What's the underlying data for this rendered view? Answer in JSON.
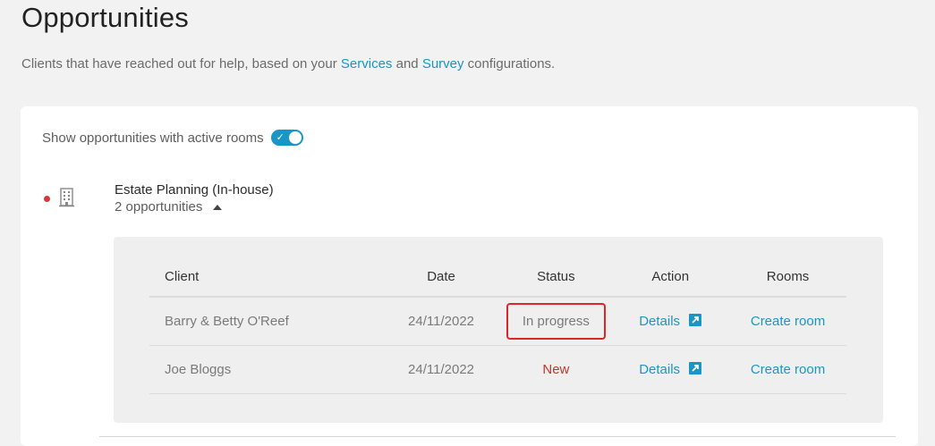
{
  "page": {
    "title": "Opportunities",
    "subtitle_before": "Clients that have reached out for help, based on your ",
    "subtitle_link1": "Services",
    "subtitle_mid": " and ",
    "subtitle_link2": "Survey",
    "subtitle_after": " configurations."
  },
  "toggle": {
    "label": "Show opportunities with active rooms",
    "check_glyph": "✓",
    "enabled": true
  },
  "service": {
    "name": "Estate Planning (In-house)",
    "count_label": "2 opportunities",
    "status_color": "#d9363e",
    "icon": "building-icon"
  },
  "table": {
    "headers": {
      "client": "Client",
      "date": "Date",
      "status": "Status",
      "action": "Action",
      "rooms": "Rooms"
    },
    "rows": [
      {
        "client": "Barry & Betty O'Reef",
        "date": "24/11/2022",
        "status": "In progress",
        "action": "Details",
        "rooms": "Create room"
      },
      {
        "client": "Joe Bloggs",
        "date": "24/11/2022",
        "status": "New",
        "action": "Details",
        "rooms": "Create room"
      }
    ]
  },
  "colors": {
    "accent": "#1a96c6",
    "new_status": "#c0392b",
    "highlight_border": "#e0242c"
  }
}
